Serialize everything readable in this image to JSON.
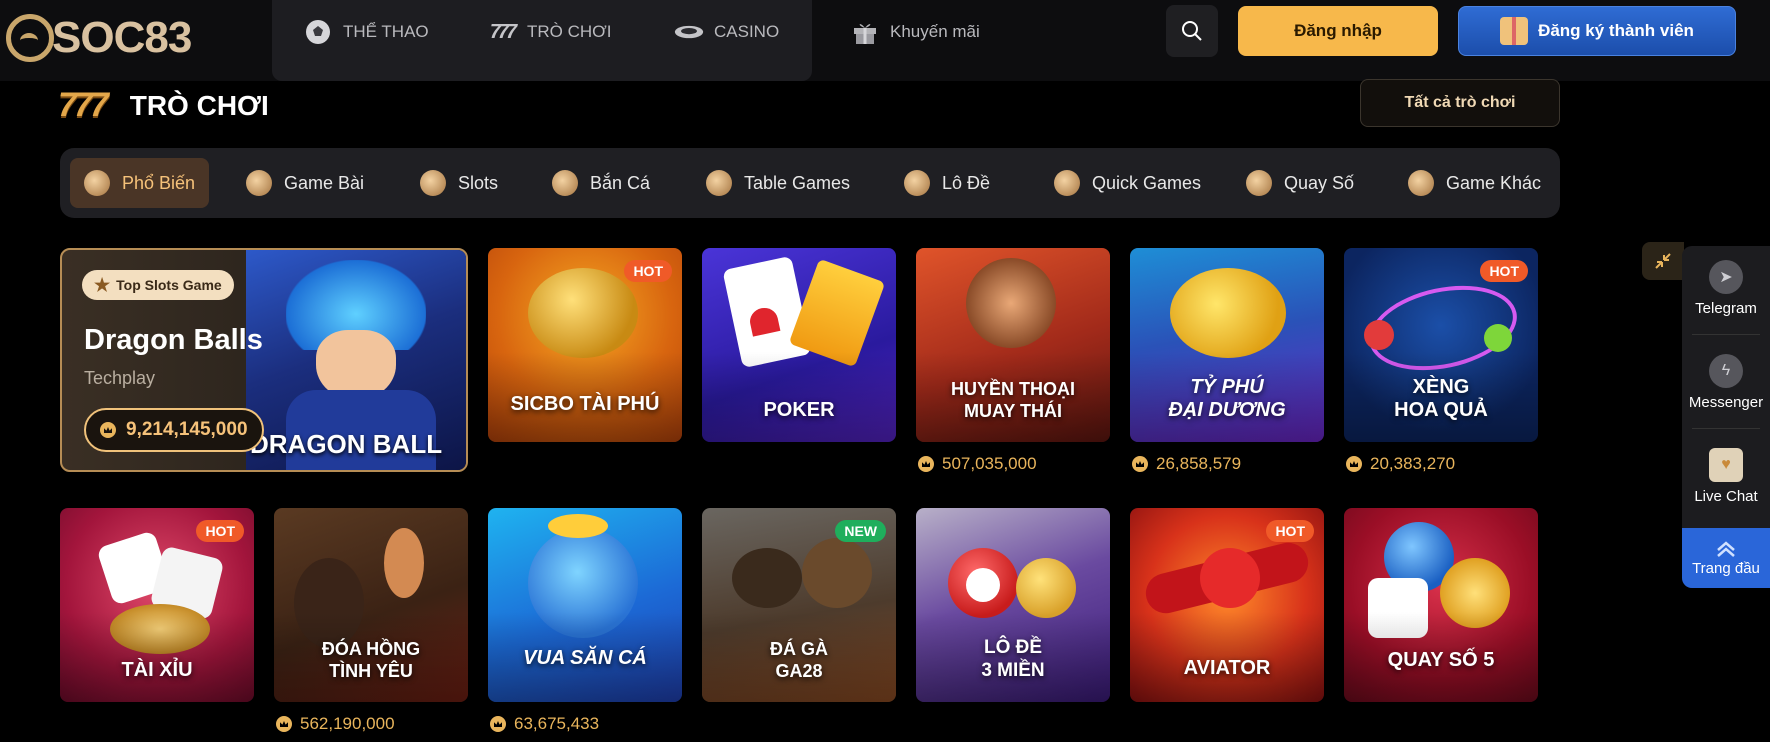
{
  "header": {
    "logo_text": "SOC83",
    "nav": [
      {
        "label": "THỂ THAO",
        "icon": "soccer-ball-icon"
      },
      {
        "label": "TRÒ CHƠI",
        "icon": "slot-777-icon"
      },
      {
        "label": "CASINO",
        "icon": "casino-chip-icon"
      },
      {
        "label": "Khuyến mãi",
        "icon": "gift-icon"
      }
    ],
    "login_label": "Đăng nhập",
    "register_label": "Đăng ký thành viên"
  },
  "section": {
    "icon_text": "777",
    "title": "TRÒ CHƠI",
    "view_all_label": "Tất cả trò chơi"
  },
  "categories": [
    {
      "label": "Phổ Biến",
      "active": true
    },
    {
      "label": "Game Bài"
    },
    {
      "label": "Slots"
    },
    {
      "label": "Bắn Cá"
    },
    {
      "label": "Table Games"
    },
    {
      "label": "Lô Đề"
    },
    {
      "label": "Quick Games"
    },
    {
      "label": "Quay Số"
    },
    {
      "label": "Game Khác"
    }
  ],
  "featured": {
    "badge": "Top Slots Game",
    "name": "Dragon Balls",
    "provider": "Techplay",
    "jackpot": "9,214,145,000",
    "art_caption": "DRAGON BALL"
  },
  "games_row1": [
    {
      "label": "SICBO TÀI PHÚ",
      "tag": "HOT",
      "jackpot": ""
    },
    {
      "label": "POKER",
      "tag": "",
      "jackpot": ""
    },
    {
      "label": "HUYỀN THOẠI\nMUAY THÁI",
      "tag": "",
      "jackpot": "507,035,000"
    },
    {
      "label": "TỶ PHÚ\nĐẠI DƯƠNG",
      "tag": "",
      "jackpot": "26,858,579"
    },
    {
      "label": "XÈNG\nHOA QUẢ",
      "tag": "HOT",
      "jackpot": "20,383,270"
    }
  ],
  "games_row2": [
    {
      "label": "TÀI XỈU",
      "tag": "HOT",
      "jackpot": ""
    },
    {
      "label": "ĐÓA HỒNG\nTÌNH YÊU",
      "tag": "",
      "jackpot": "562,190,000"
    },
    {
      "label": "VUA SĂN CÁ",
      "tag": "",
      "jackpot": "63,675,433"
    },
    {
      "label": "ĐÁ GÀ\nGA28",
      "tag": "NEW",
      "jackpot": ""
    },
    {
      "label": "LÔ ĐỀ\n3 MIỀN",
      "tag": "",
      "jackpot": ""
    },
    {
      "label": "AVIATOR",
      "tag": "HOT",
      "jackpot": ""
    },
    {
      "label": "QUAY SỐ 5",
      "tag": "",
      "jackpot": ""
    }
  ],
  "sidebar": {
    "items": [
      "Telegram",
      "Messenger",
      "Live Chat"
    ],
    "top_label": "Trang đầu"
  },
  "colors": {
    "accent": "#f7b84b",
    "register": "#2a66d9",
    "hot": "#f05a28",
    "new": "#1fae5c"
  }
}
